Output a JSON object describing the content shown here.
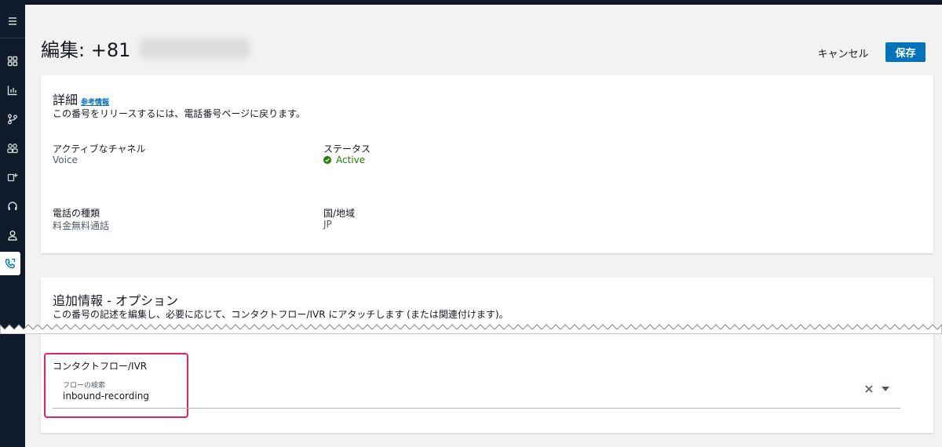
{
  "header": {
    "title": "編集: +81",
    "cancel_label": "キャンセル",
    "save_label": "保存"
  },
  "sidebar": {
    "items": [
      {
        "icon": "menu-icon"
      },
      {
        "icon": "dashboard-icon"
      },
      {
        "icon": "analytics-icon"
      },
      {
        "icon": "routing-icon"
      },
      {
        "icon": "users-icon"
      },
      {
        "icon": "channels-icon"
      },
      {
        "icon": "headset-icon"
      },
      {
        "icon": "user-icon"
      },
      {
        "icon": "phone-numbers-icon",
        "active": true
      }
    ]
  },
  "details": {
    "title": "詳細",
    "info_link": "参考情報",
    "description": "この番号をリリースするには、電話番号ページに戻ります。",
    "fields": {
      "channel_label": "アクティブなチャネル",
      "channel_value": "Voice",
      "status_label": "ステータス",
      "status_value": "Active",
      "type_label": "電話の種類",
      "type_value": "料金無料通話",
      "country_label": "国/地域",
      "country_value": "JP"
    }
  },
  "additional": {
    "title": "追加情報 - オプション",
    "description": "この番号の記述を編集し、必要に応じて、コンタクトフロー/IVR にアタッチします (または関連付けます)。",
    "flow_label": "コンタクトフロー/IVR",
    "search_label": "フローの検索",
    "search_value": "inbound-recording"
  },
  "colors": {
    "accent": "#0073bb",
    "status_active": "#1d8102",
    "highlight": "#e0245e",
    "sidebar_bg": "#0f1b2a"
  }
}
